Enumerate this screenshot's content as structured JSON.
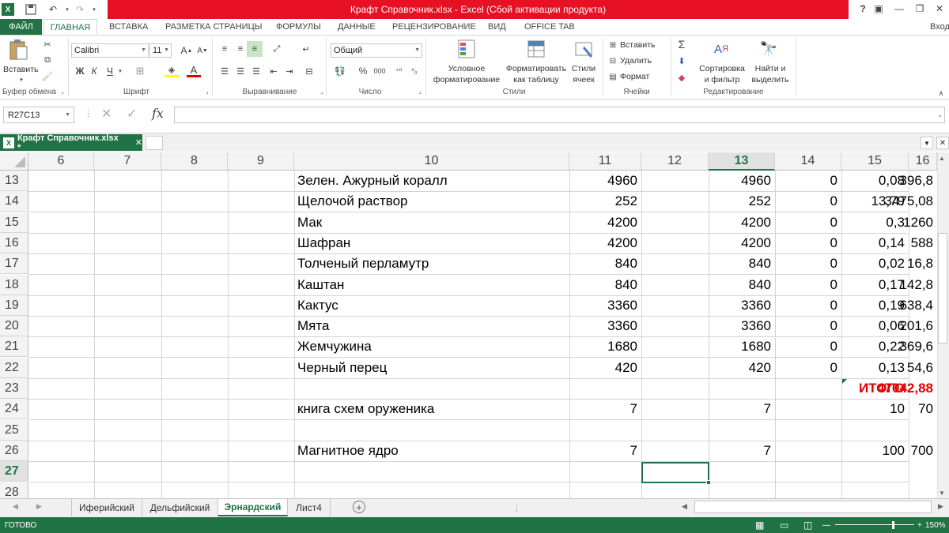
{
  "title": "Крафт Справочник.xlsx -  Excel (Сбой активации продукта)",
  "window": {
    "help": "?",
    "signin": "Вход"
  },
  "ribbon_tabs": [
    "ФАЙЛ",
    "ГЛАВНАЯ",
    "ВСТАВКА",
    "РАЗМЕТКА СТРАНИЦЫ",
    "ФОРМУЛЫ",
    "ДАННЫЕ",
    "РЕЦЕНЗИРОВАНИЕ",
    "ВИД",
    "OFFICE TAB"
  ],
  "ribbon": {
    "paste_label": "Вставить",
    "font_name": "Calibri",
    "font_size": "11",
    "bold": "Ж",
    "italic": "К",
    "underline": "Ч",
    "number_format": "Общий",
    "percent": "%",
    "thousands": "000",
    "cond_format_1": "Условное",
    "cond_format_2": "форматирование",
    "format_table_1": "Форматировать",
    "format_table_2": "как таблицу",
    "cell_styles_1": "Стили",
    "cell_styles_2": "ячеек",
    "insert": "Вставить",
    "delete": "Удалить",
    "format": "Формат",
    "sort_1": "Сортировка",
    "sort_2": "и фильтр",
    "find_1": "Найти и",
    "find_2": "выделить",
    "groups": {
      "clipboard": "Буфер обмена",
      "font": "Шрифт",
      "alignment": "Выравнивание",
      "number": "Число",
      "styles": "Стили",
      "cells": "Ячейки",
      "editing": "Редактирование"
    }
  },
  "formula_bar": {
    "name_box": "R27C13",
    "fx": "fx",
    "value": ""
  },
  "doc_tab": "Крафт Справочник.xlsx *",
  "columns": [
    "6",
    "7",
    "8",
    "9",
    "10",
    "11",
    "12",
    "13",
    "14",
    "15",
    "16"
  ],
  "rows": [
    {
      "n": "13",
      "name": "Зелен. Ажурный коралл",
      "c11": "4960",
      "c13": "4960",
      "c14": "0",
      "c15": "0,08",
      "c16": "396,8"
    },
    {
      "n": "14",
      "name": "Щелочой раствор",
      "c11": "252",
      "c13": "252",
      "c14": "0",
      "c15": "13,79",
      "c16": "3475,08"
    },
    {
      "n": "15",
      "name": "Мак",
      "c11": "4200",
      "c13": "4200",
      "c14": "0",
      "c15": "0,3",
      "c16": "1260"
    },
    {
      "n": "16",
      "name": "Шафран",
      "c11": "4200",
      "c13": "4200",
      "c14": "0",
      "c15": "0,14",
      "c16": "588"
    },
    {
      "n": "17",
      "name": "Толченый перламутр",
      "c11": "840",
      "c13": "840",
      "c14": "0",
      "c15": "0,02",
      "c16": "16,8"
    },
    {
      "n": "18",
      "name": "Каштан",
      "c11": "840",
      "c13": "840",
      "c14": "0",
      "c15": "0,17",
      "c16": "142,8"
    },
    {
      "n": "19",
      "name": "Кактус",
      "c11": "3360",
      "c13": "3360",
      "c14": "0",
      "c15": "0,19",
      "c16": "638,4"
    },
    {
      "n": "20",
      "name": "Мята",
      "c11": "3360",
      "c13": "3360",
      "c14": "0",
      "c15": "0,06",
      "c16": "201,6"
    },
    {
      "n": "21",
      "name": "Жемчужина",
      "c11": "1680",
      "c13": "1680",
      "c14": "0",
      "c15": "0,22",
      "c16": "369,6"
    },
    {
      "n": "22",
      "name": "Черный перец",
      "c11": "420",
      "c13": "420",
      "c14": "0",
      "c15": "0,13",
      "c16": "54,6"
    },
    {
      "n": "23",
      "name": "",
      "c11": "",
      "c13": "",
      "c14": "",
      "c15": "ИТОГО",
      "c16": "47042,88"
    },
    {
      "n": "24",
      "name": "книга схем оруженика",
      "c11": "7",
      "c13": "7",
      "c14": "",
      "c15": "10",
      "c16": "70"
    },
    {
      "n": "25",
      "name": "",
      "c11": "",
      "c13": "",
      "c14": "",
      "c15": "",
      "c16": ""
    },
    {
      "n": "26",
      "name": "Магнитное ядро",
      "c11": "7",
      "c13": "7",
      "c14": "",
      "c15": "100",
      "c16": "700"
    },
    {
      "n": "27",
      "name": "",
      "c11": "",
      "c13": "",
      "c14": "",
      "c15": "",
      "c16": ""
    },
    {
      "n": "28",
      "name": "",
      "c11": "",
      "c13": "",
      "c14": "",
      "c15": "",
      "c16": ""
    }
  ],
  "sheets": [
    "Иферийский",
    "Дельфийский",
    "Эрнардский",
    "Лист4"
  ],
  "active_sheet": "Эрнардский",
  "status": {
    "ready": "ГОТОВО",
    "zoom": "150%"
  },
  "colors": {
    "accent": "#217346",
    "title_red": "#e81123",
    "total_red": "#e00000"
  }
}
